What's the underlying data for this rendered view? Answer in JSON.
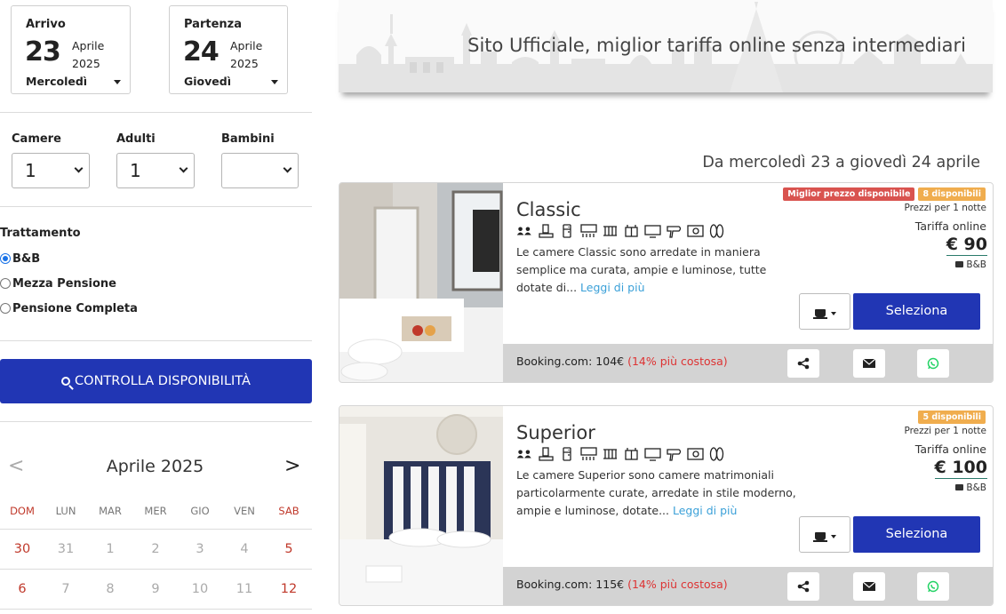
{
  "booking": {
    "arrival": {
      "label": "Arrivo",
      "day": "23",
      "month": "Aprile",
      "year": "2025",
      "weekday": "Mercoledì"
    },
    "departure": {
      "label": "Partenza",
      "day": "24",
      "month": "Aprile",
      "year": "2025",
      "weekday": "Giovedì"
    },
    "rooms": {
      "label": "Camere",
      "value": "1"
    },
    "adults": {
      "label": "Adulti",
      "value": "1"
    },
    "children": {
      "label": "Bambini",
      "value": ""
    }
  },
  "treatment": {
    "label": "Trattamento",
    "options": [
      {
        "label": "B&B",
        "selected": true
      },
      {
        "label": "Mezza Pensione",
        "selected": false
      },
      {
        "label": "Pensione Completa",
        "selected": false
      }
    ]
  },
  "check_button": "CONTROLLA DISPONIBILITÀ",
  "calendar": {
    "prev": "<",
    "next": ">",
    "title": "Aprile 2025",
    "weekdays": [
      "DOM",
      "LUN",
      "MAR",
      "MER",
      "GIO",
      "VEN",
      "SAB"
    ],
    "weeks": [
      [
        "30",
        "31",
        "1",
        "2",
        "3",
        "4",
        "5"
      ],
      [
        "6",
        "7",
        "8",
        "9",
        "10",
        "11",
        "12"
      ]
    ]
  },
  "banner": {
    "text": "Sito Ufficiale, miglior tariffa online senza intermediari"
  },
  "date_range": "Da mercoledì 23 a giovedì 24 aprile",
  "rooms_list": [
    {
      "name": "Classic",
      "badges": [
        "Miglior prezzo disponibile",
        "8 disponibili"
      ],
      "desc": "Le camere Classic sono arredate in maniera semplice ma curata, ampie e luminose, tutte dotate di...",
      "more": "Leggi di più",
      "per_night": "Prezzi per 1 notte",
      "tariff_label": "Tariffa online",
      "price": "€ 90",
      "plan": "B&B",
      "select": "Seleziona",
      "booking_text": "Booking.com: 104€",
      "booking_pct": "(14% più costosa)"
    },
    {
      "name": "Superior",
      "badges": [
        "5 disponibili"
      ],
      "desc": "Le camere  Superior sono camere matrimoniali particolarmente curate, arredate in stile moderno, ampie e luminose, dotate...",
      "more": "Leggi di più",
      "per_night": "Prezzi per 1 notte",
      "tariff_label": "Tariffa online",
      "price": "€ 100",
      "plan": "B&B",
      "select": "Seleziona",
      "booking_text": "Booking.com: 115€",
      "booking_pct": "(14% più costosa)"
    }
  ],
  "amenity_icons": [
    "two-people-icon",
    "tv-stand-icon",
    "fridge-icon",
    "air-conditioner-icon",
    "radiator-icon",
    "wardrobe-icon",
    "monitor-icon",
    "hairdryer-icon",
    "safe-icon",
    "slippers-icon"
  ],
  "colors": {
    "primary": "#2136b4",
    "badge_red": "#d9534f",
    "badge_orange": "#f0ad4e",
    "link": "#3aa0d8",
    "weekend": "#c0392b",
    "whatsapp": "#25d366"
  }
}
